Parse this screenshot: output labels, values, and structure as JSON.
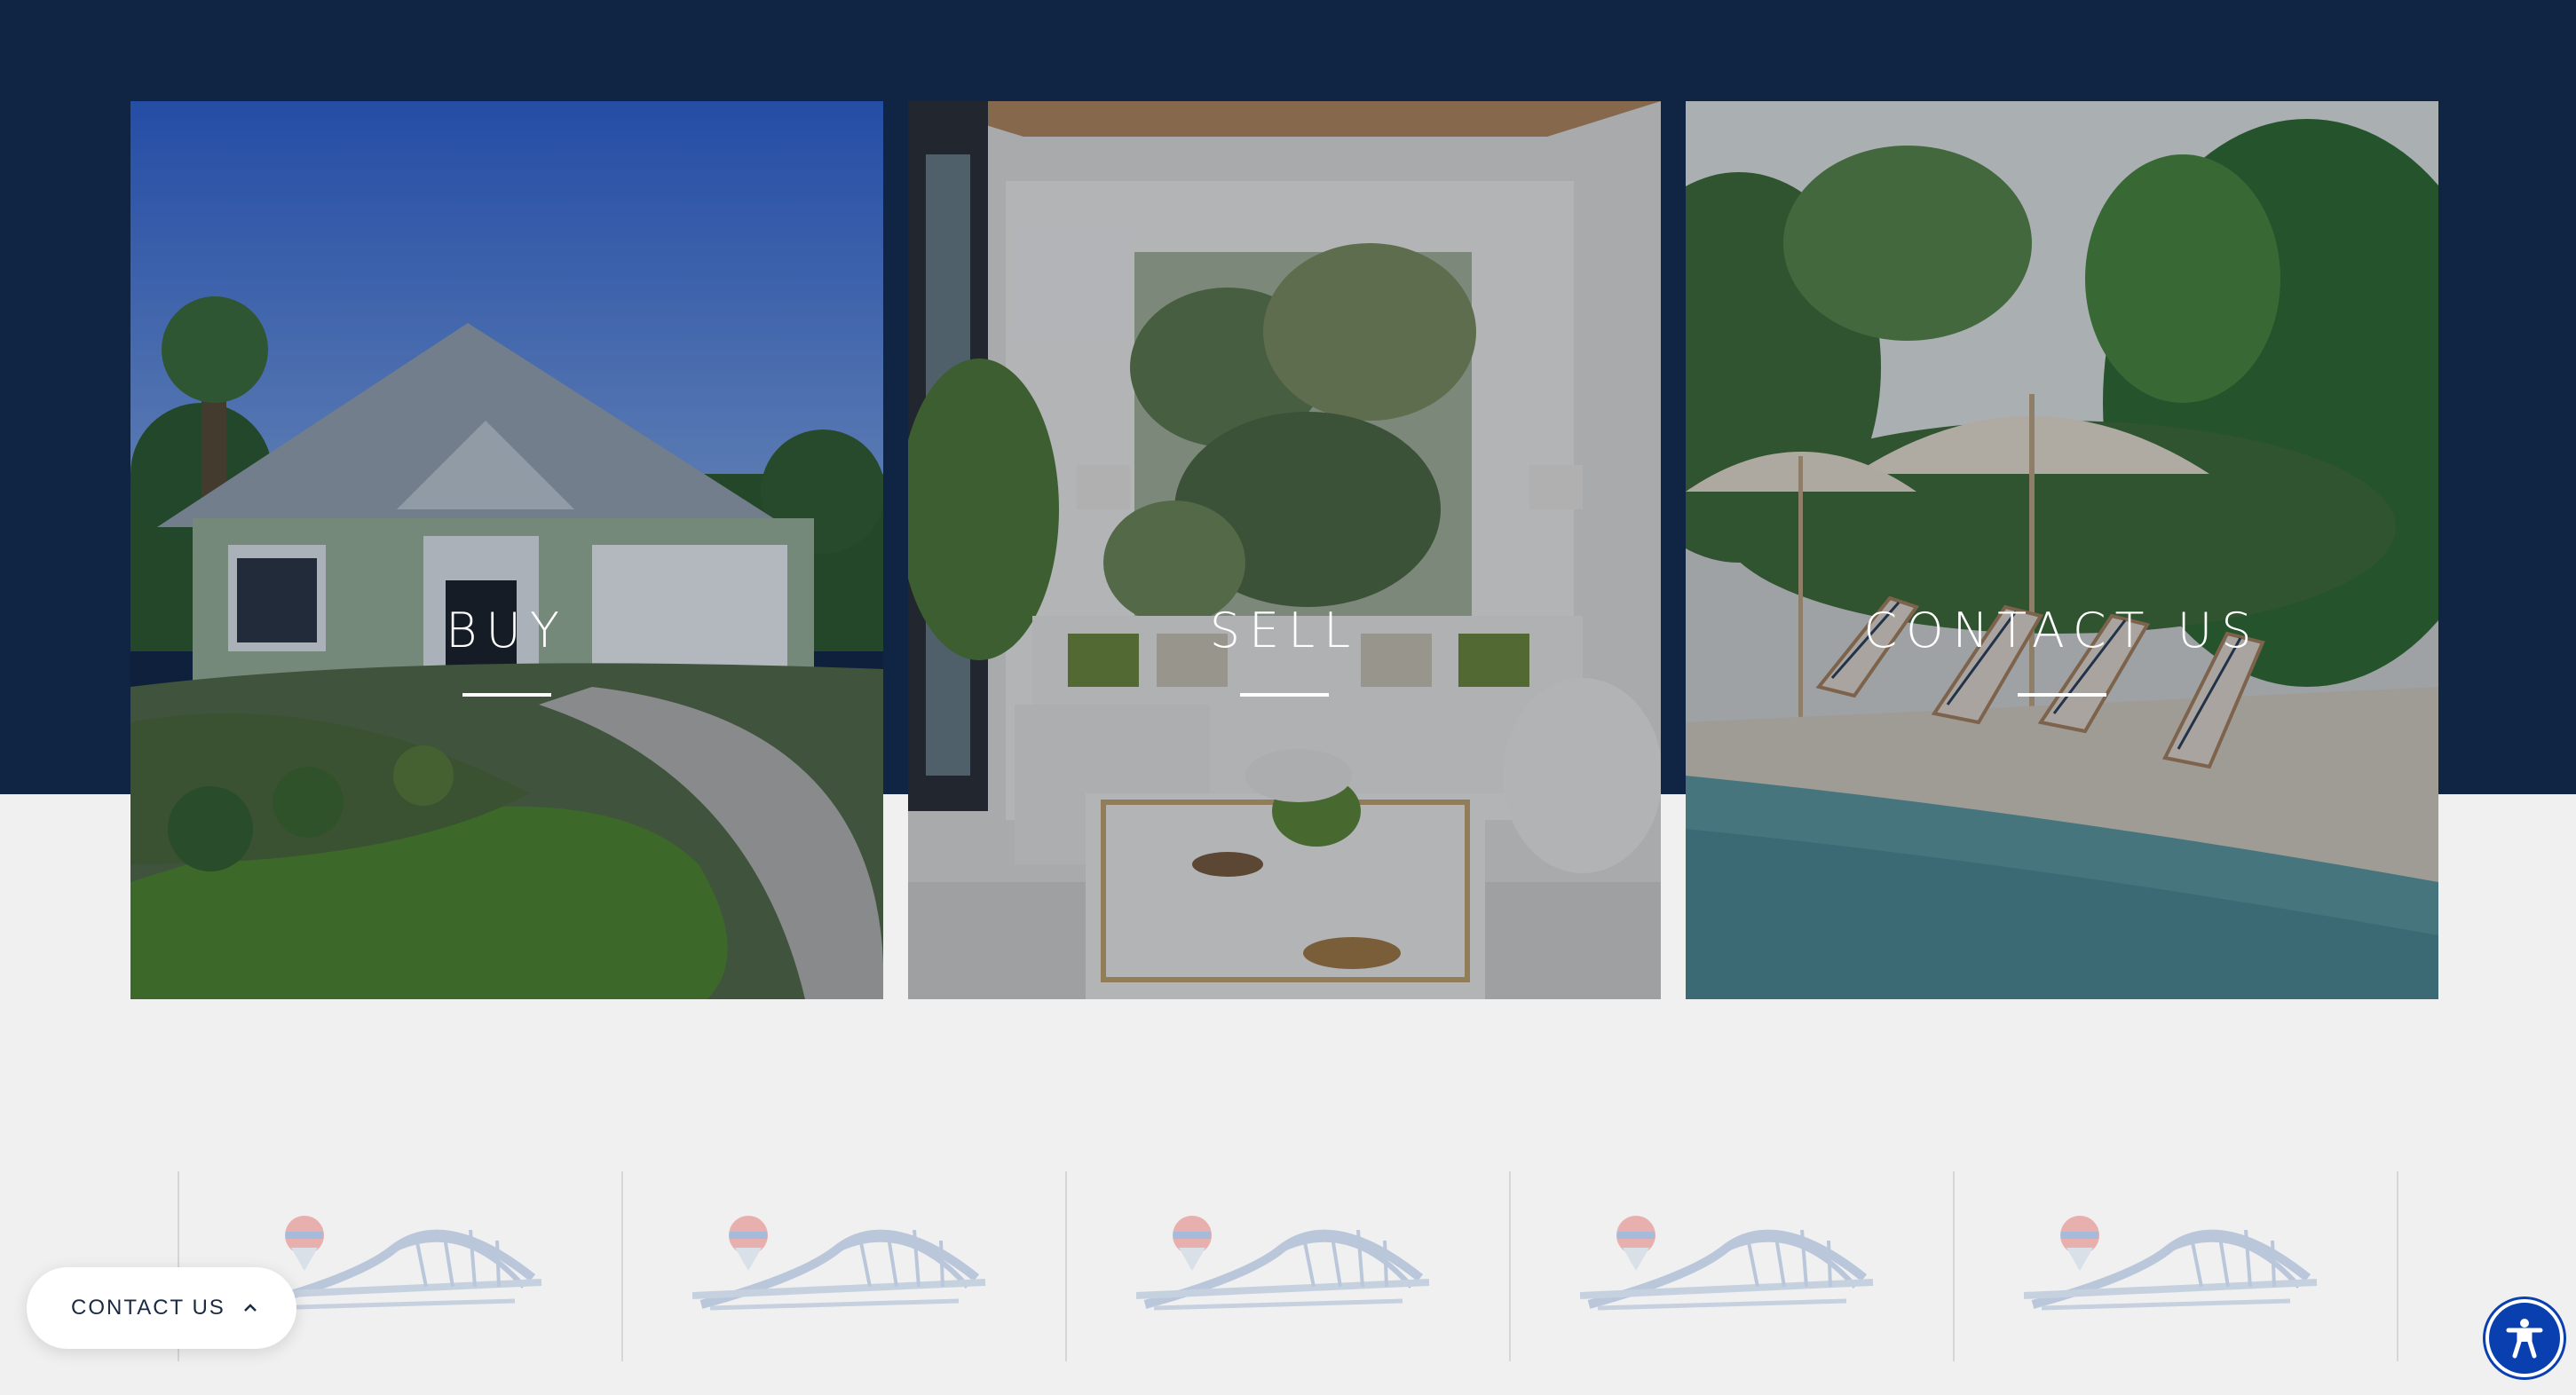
{
  "colors": {
    "navy": "#102444",
    "background": "#f0f0f0",
    "accessibility_blue": "#0a3fb0"
  },
  "cards": [
    {
      "label": "BUY"
    },
    {
      "label": "SELL"
    },
    {
      "label": "CONTACT US"
    }
  ],
  "logo_strip": {
    "logo_icon": "remax-balloon-bridge-logo",
    "count": 5
  },
  "contact_pill": {
    "label": "CONTACT US",
    "icon": "chevron-up-icon"
  },
  "accessibility_button": {
    "icon": "accessibility-person-icon"
  }
}
